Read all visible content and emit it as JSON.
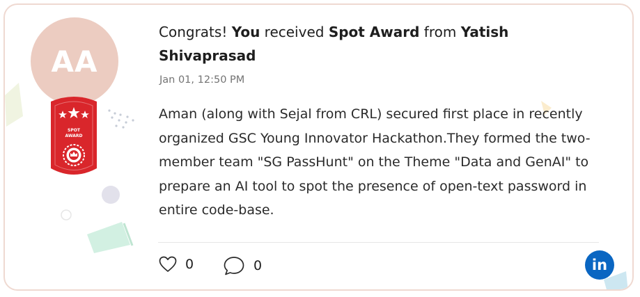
{
  "avatar": {
    "initials": "AA",
    "bg_color": "#ecccc1"
  },
  "badge": {
    "line1": "SPOT",
    "line2": "AWARD",
    "color": "#d9262b"
  },
  "headline": {
    "prefix": "Congrats! ",
    "recipient": "You",
    "mid1": " received ",
    "award": "Spot Award",
    "mid2": " from ",
    "sender": "Yatish Shivaprasad"
  },
  "timestamp": "Jan 01, 12:50 PM",
  "message": "Aman (along with Sejal from CRL) secured first place in recently organized GSC Young Innovator Hackathon.They formed the two-member team \"SG PassHunt\" on the Theme \"Data and GenAI\" to prepare an AI tool to spot the presence of open-text password in entire code-base.",
  "actions": {
    "like_icon": "heart-icon",
    "like_count": "0",
    "comment_icon": "comment-icon",
    "comment_count": "0"
  },
  "share": {
    "icon": "linkedin-icon",
    "label": "in",
    "color": "#0a66c2"
  }
}
